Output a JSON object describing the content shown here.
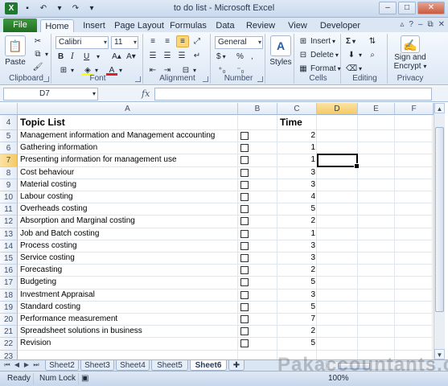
{
  "app": {
    "window_title": "to do list - Microsoft Excel",
    "colors": {
      "file_tab": "#1f6e22",
      "active_cell_border": "#000000",
      "selected_header": "#f5c965"
    }
  },
  "ribbon_tabs": [
    "File",
    "Home",
    "Insert",
    "Page Layout",
    "Formulas",
    "Data",
    "Review",
    "View",
    "Developer"
  ],
  "active_tab": "Home",
  "ribbon": {
    "clipboard": {
      "label": "Clipboard",
      "paste": "Paste"
    },
    "font": {
      "label": "Font",
      "font_name": "Calibri",
      "font_size": "11",
      "bold": "B",
      "italic": "I",
      "underline": "U"
    },
    "alignment": {
      "label": "Alignment"
    },
    "number": {
      "label": "Number",
      "format": "General",
      "currency": "$",
      "percent": "%",
      "comma": ","
    },
    "styles": {
      "label": "Styles"
    },
    "cells": {
      "label": "Cells",
      "insert": "Insert",
      "delete": "Delete",
      "format": "Format"
    },
    "editing": {
      "label": "Editing",
      "sum": "Σ"
    },
    "privacy": {
      "label": "Privacy",
      "sign_encrypt_1": "Sign and",
      "sign_encrypt_2": "Encrypt"
    }
  },
  "formula_bar": {
    "name_box": "D7",
    "fx": "fx",
    "formula": ""
  },
  "columns": [
    "A",
    "B",
    "C",
    "D",
    "E",
    "F"
  ],
  "selected_column": "D",
  "rows": [
    {
      "n": "4",
      "topic": "Topic List",
      "time": "Time",
      "header": true,
      "checkbox": false
    },
    {
      "n": "5",
      "topic": "Management information and Management accounting",
      "time": "2",
      "checkbox": true
    },
    {
      "n": "6",
      "topic": "Gathering information",
      "time": "1",
      "checkbox": true
    },
    {
      "n": "7",
      "topic": "Presenting information for management use",
      "time": "1",
      "checkbox": true
    },
    {
      "n": "8",
      "topic": "Cost behaviour",
      "time": "3",
      "checkbox": true
    },
    {
      "n": "9",
      "topic": "Material costing",
      "time": "3",
      "checkbox": true
    },
    {
      "n": "10",
      "topic": "Labour costing",
      "time": "4",
      "checkbox": true
    },
    {
      "n": "11",
      "topic": "Overheads costing",
      "time": "5",
      "checkbox": true
    },
    {
      "n": "12",
      "topic": "Absorption and Marginal costing",
      "time": "2",
      "checkbox": true
    },
    {
      "n": "13",
      "topic": "Job and Batch costing",
      "time": "1",
      "checkbox": true
    },
    {
      "n": "14",
      "topic": "Process costing",
      "time": "3",
      "checkbox": true
    },
    {
      "n": "15",
      "topic": "Service costing",
      "time": "3",
      "checkbox": true
    },
    {
      "n": "16",
      "topic": "Forecasting",
      "time": "2",
      "checkbox": true
    },
    {
      "n": "17",
      "topic": "Budgeting",
      "time": "5",
      "checkbox": true
    },
    {
      "n": "18",
      "topic": "Investment Appraisal",
      "time": "3",
      "checkbox": true
    },
    {
      "n": "19",
      "topic": "Standard costing",
      "time": "5",
      "checkbox": true
    },
    {
      "n": "20",
      "topic": "Performance measurement",
      "time": "7",
      "checkbox": true
    },
    {
      "n": "21",
      "topic": "Spreadsheet solutions in business",
      "time": "2",
      "checkbox": true
    },
    {
      "n": "22",
      "topic": "Revision",
      "time": "5",
      "checkbox": true
    },
    {
      "n": "23",
      "topic": "",
      "time": "",
      "checkbox": false
    }
  ],
  "selected_row": "7",
  "sheet_tabs": [
    "Sheet2",
    "Sheet3",
    "Sheet4",
    "Sheet5",
    "Sheet6"
  ],
  "active_sheet": "Sheet6",
  "status": {
    "ready": "Ready",
    "num_lock": "Num Lock",
    "zoom": "100%"
  },
  "watermark": "Pakaccountants.com"
}
